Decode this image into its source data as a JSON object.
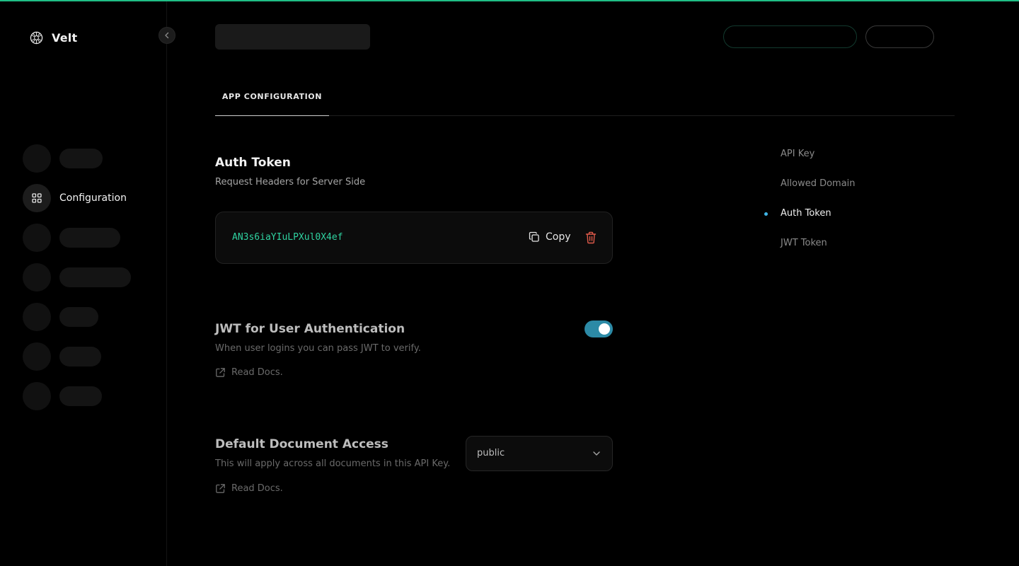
{
  "app": {
    "name": "Velt"
  },
  "colors": {
    "accent": "#1fbf86",
    "token": "#2fd2a0",
    "toggle": "#2c8aa6",
    "toc_active_dot": "#3fb4e6",
    "delete": "#e05a4a"
  },
  "sidebar": {
    "active_item": {
      "label": "Configuration",
      "icon": "grid-icon"
    }
  },
  "tabs": [
    {
      "label": "APP CONFIGURATION"
    }
  ],
  "auth_token": {
    "title": "Auth Token",
    "subtitle": "Request Headers for Server Side",
    "token": "AN3s6iaYIuLPXul0X4ef",
    "copy_label": "Copy"
  },
  "jwt": {
    "title": "JWT for User Authentication",
    "description": "When user logins you can pass JWT to verify.",
    "docs_label": "Read Docs.",
    "enabled": true
  },
  "document_access": {
    "title": "Default Document Access",
    "description": "This will apply across all documents in this API Key.",
    "docs_label": "Read Docs.",
    "selected": "public"
  },
  "toc": {
    "items": [
      {
        "label": "API Key"
      },
      {
        "label": "Allowed Domain"
      },
      {
        "label": "Auth Token"
      },
      {
        "label": "JWT Token"
      }
    ],
    "active": "Auth Token"
  }
}
